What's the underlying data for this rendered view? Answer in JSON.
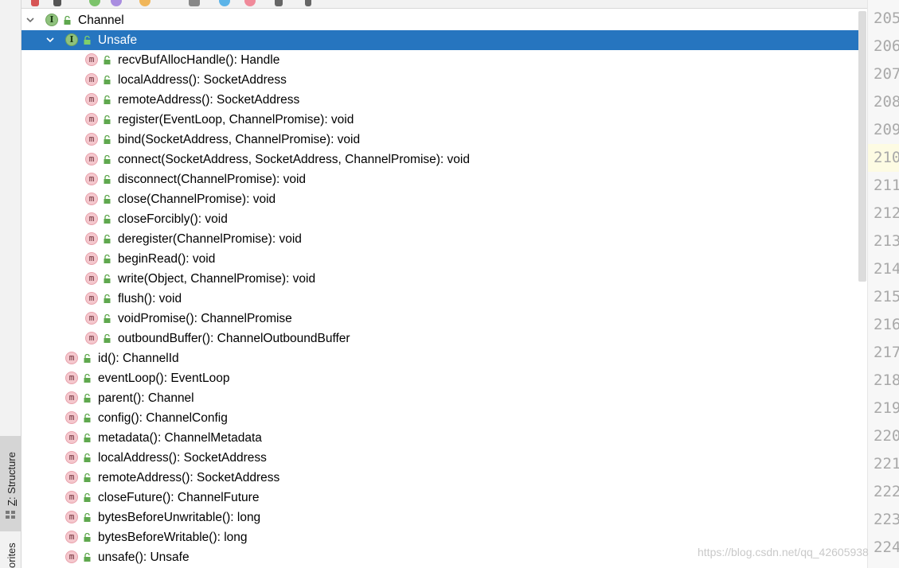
{
  "left_strip": {
    "structure_mnemonic": "Z",
    "structure_label": ": Structure",
    "favorites_label": "orites"
  },
  "tree": {
    "root": {
      "label": "Channel",
      "icon": "interface-icon"
    },
    "unsafe": {
      "label": "Unsafe",
      "icon": "interface-icon"
    },
    "unsafe_methods": [
      "recvBufAllocHandle(): Handle",
      "localAddress(): SocketAddress",
      "remoteAddress(): SocketAddress",
      "register(EventLoop, ChannelPromise): void",
      "bind(SocketAddress, ChannelPromise): void",
      "connect(SocketAddress, SocketAddress, ChannelPromise): void",
      "disconnect(ChannelPromise): void",
      "close(ChannelPromise): void",
      "closeForcibly(): void",
      "deregister(ChannelPromise): void",
      "beginRead(): void",
      "write(Object, ChannelPromise): void",
      "flush(): void",
      "voidPromise(): ChannelPromise",
      "outboundBuffer(): ChannelOutboundBuffer"
    ],
    "channel_methods": [
      "id(): ChannelId",
      "eventLoop(): EventLoop",
      "parent(): Channel",
      "config(): ChannelConfig",
      "metadata(): ChannelMetadata",
      "localAddress(): SocketAddress",
      "remoteAddress(): SocketAddress",
      "closeFuture(): ChannelFuture",
      "bytesBeforeUnwritable(): long",
      "bytesBeforeWritable(): long",
      "unsafe(): Unsafe"
    ],
    "method_icon_letter": "m",
    "interface_icon_letter": "I"
  },
  "gutter": {
    "line_numbers": [
      "205",
      "206",
      "207",
      "208",
      "209",
      "210",
      "211",
      "212",
      "213",
      "214",
      "215",
      "216",
      "217",
      "218",
      "219",
      "220",
      "221",
      "222",
      "223",
      "224"
    ],
    "current_line": "210"
  },
  "watermark": "https://blog.csdn.net/qq_42605938",
  "colors": {
    "selection": "#2675bf",
    "method_icon": "#f4c7cd",
    "interface_icon": "#8fc27d",
    "public_lock": "#5fa84e"
  }
}
